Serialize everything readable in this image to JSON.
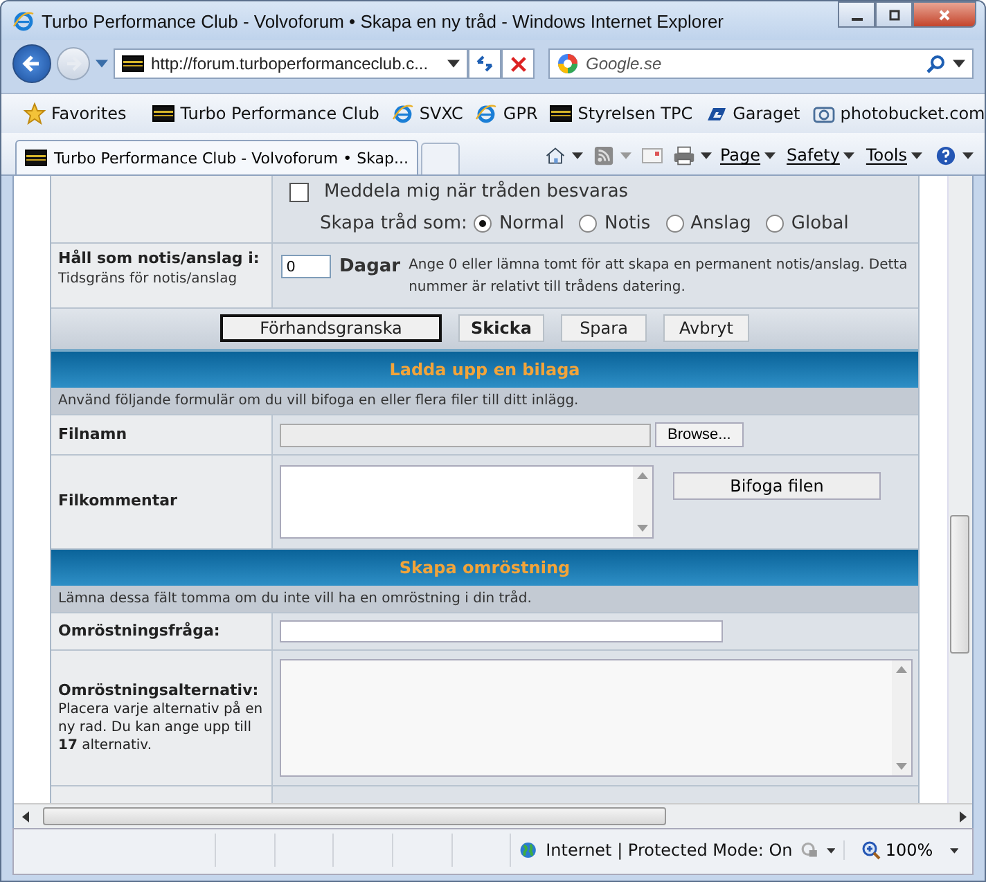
{
  "window": {
    "title": "Turbo Performance Club - Volvoforum • Skapa en ny tråd - Windows Internet Explorer"
  },
  "address_bar": {
    "url": "http://forum.turboperformanceclub.c..."
  },
  "search": {
    "placeholder": "Google.se"
  },
  "favorites_bar": {
    "label": "Favorites",
    "items": [
      {
        "label": "Turbo Performance Club",
        "kind": "club"
      },
      {
        "label": "SVXC",
        "kind": "ie"
      },
      {
        "label": "GPR",
        "kind": "ie"
      },
      {
        "label": "Styrelsen TPC",
        "kind": "club"
      },
      {
        "label": "Garaget",
        "kind": "garage"
      },
      {
        "label": "photobucket.com",
        "kind": "camera"
      }
    ]
  },
  "tab": {
    "title": "Turbo Performance Club - Volvoforum • Skap..."
  },
  "command_bar": {
    "menus": [
      "Page",
      "Safety",
      "Tools"
    ]
  },
  "options": {
    "notify": {
      "label": "Meddela mig när tråden besvaras",
      "checked": false
    },
    "thread_type": {
      "label": "Skapa tråd som:",
      "choices": [
        {
          "label": "Normal",
          "selected": true
        },
        {
          "label": "Notis",
          "selected": false
        },
        {
          "label": "Anslag",
          "selected": false
        },
        {
          "label": "Global",
          "selected": false
        }
      ]
    }
  },
  "sticky_duration": {
    "label": "Håll som notis/anslag i:",
    "hint": "Tidsgräns för notis/anslag",
    "value": "0",
    "unit": "Dagar",
    "note": "Ange 0 eller lämna tomt för att skapa en permanent notis/anslag. Detta nummer är relativt till trådens datering."
  },
  "form_buttons": [
    {
      "label": "Förhandsgranska",
      "focused": true,
      "bold": false
    },
    {
      "label": "Skicka",
      "focused": false,
      "bold": true
    },
    {
      "label": "Spara",
      "focused": false,
      "bold": false
    },
    {
      "label": "Avbryt",
      "focused": false,
      "bold": false
    }
  ],
  "attachment": {
    "title": "Ladda upp en bilaga",
    "description": "Använd följande formulär om du vill bifoga en eller flera filer till ditt inlägg.",
    "filename_label": "Filnamn",
    "browse_button": "Browse...",
    "comment_label": "Filkommentar",
    "attach_button": "Bifoga filen"
  },
  "poll": {
    "title": "Skapa omröstning",
    "description": "Lämna dessa fält tomma om du inte vill ha en omröstning i din tråd.",
    "question_label": "Omröstningsfråga:",
    "options_label": "Omröstningsalternativ:",
    "options_hint": "Placera varje alternativ på en ny rad. Du kan ange upp till **17** alternativ."
  },
  "status_bar": {
    "zone": "Internet | Protected Mode: On",
    "zoom": "100%"
  }
}
